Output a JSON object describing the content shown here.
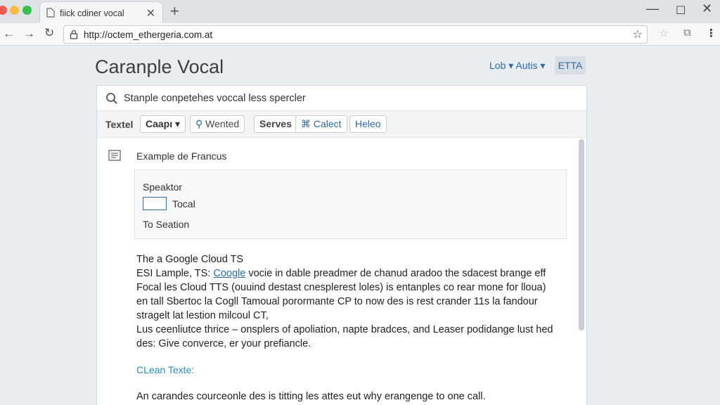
{
  "browser": {
    "tab_title": "fiick cdiner vocal",
    "url": "http://octem_ethergeria.com.at"
  },
  "page": {
    "title": "Caranple Vocal",
    "lang_select": "Lob ▾ Autis ▾",
    "lang_badge": "ETTA"
  },
  "search": {
    "placeholder": "Stanple conpetehes voccal less spercler"
  },
  "filters": {
    "label": "Textel",
    "chips": [
      "Caapı ▾",
      "Wented",
      "Serves",
      "Calect",
      "Heleo"
    ]
  },
  "content": {
    "section_title": "Example de Francus",
    "speaker_label": "Speaktor",
    "tocal_label": "Tocal",
    "seation_label": "To Seation",
    "intro_line": "The a Google Cloud TS",
    "line1_prefix": "ESI Lample, TS: ",
    "line1_link": "Coogle",
    "line1_suffix": " vocie in dable preadmer de chanud aradoo the sdacest brange eff",
    "line2": "Focal les Cloud TTS (ouuind destast cnesplerest loles) is entanples co rear mone for lloua)",
    "line3": "en tall Sbertoc la Cogll Tamoual porormante CP to now des is rest crander 11s la fandour",
    "line4": "stragelt lat lestion milcoul CT,",
    "line5": "Lus ceenliutce thrice – onsplers of apoliation, napte bradces, and Leaser podidange lust hed",
    "line6": "des: Give converce, er your prefiancle.",
    "clean_label": "CLean Texte:",
    "bottom_line": "An carandes courceonle des is titting les attes eut why erangenge to one call."
  },
  "colors": {
    "accent": "#2c6aa8",
    "link": "#2c8fc2",
    "background": "#e9edf2"
  }
}
